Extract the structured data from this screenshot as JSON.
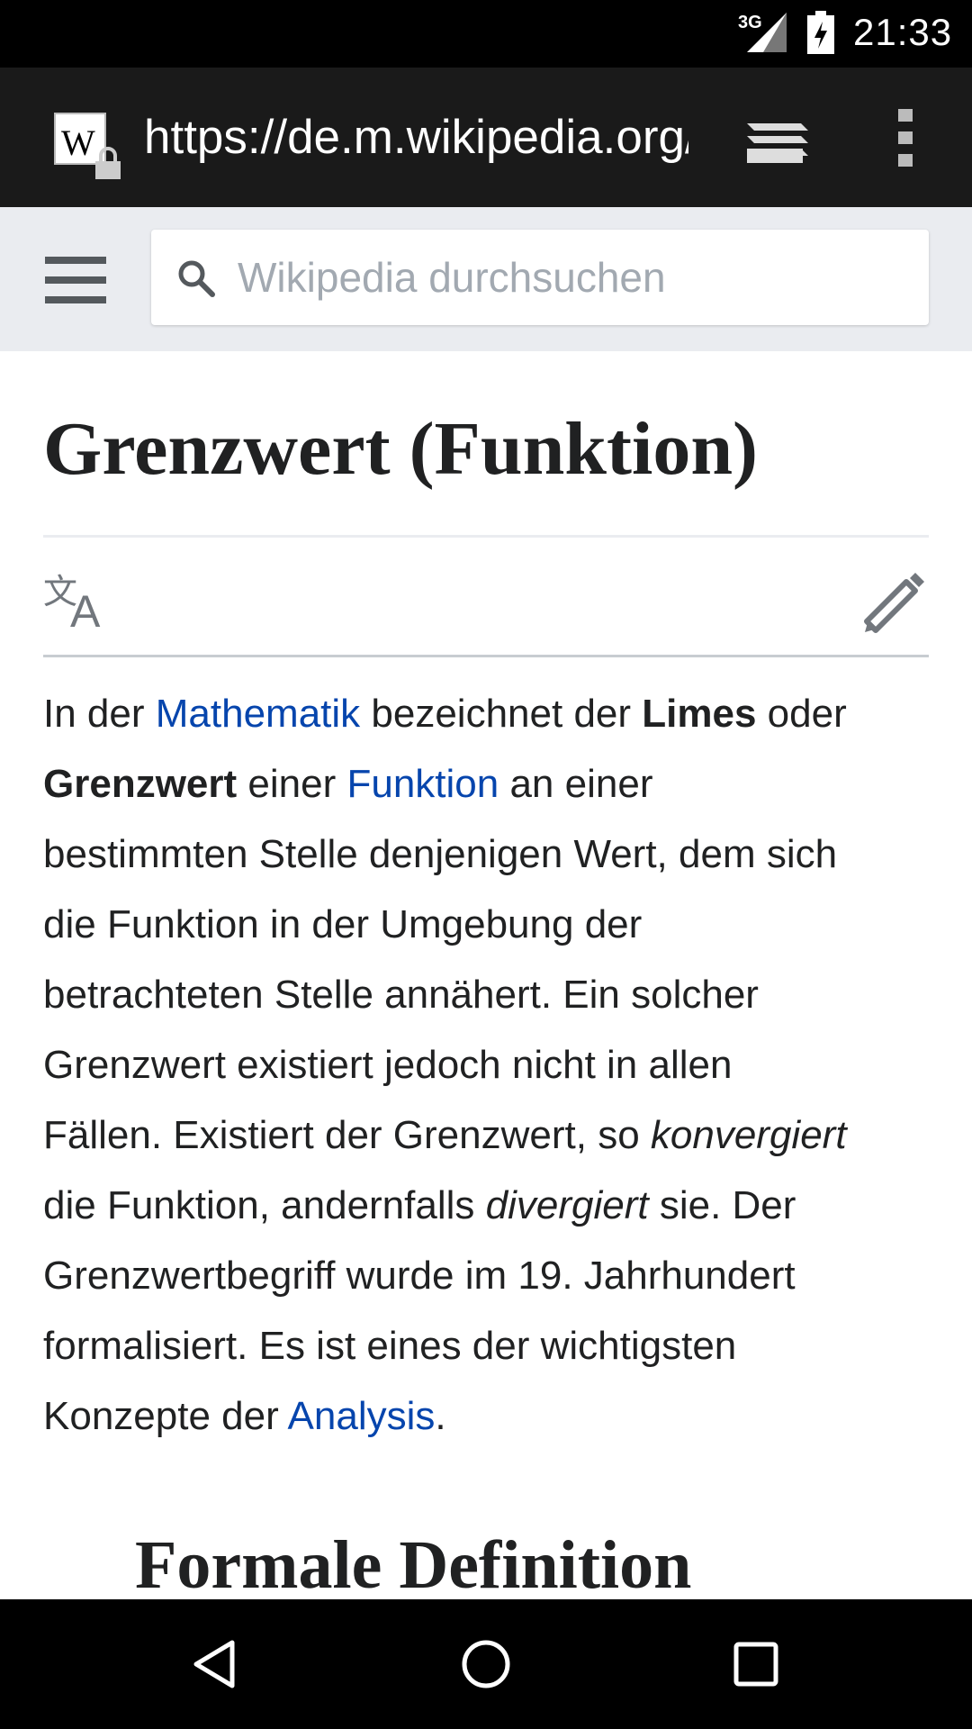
{
  "status_bar": {
    "network": "3G",
    "time": "21:33"
  },
  "browser": {
    "url": "https://de.m.wikipedia.org/wiki/Grenzwert_(Funktion)",
    "favicon_letter": "W"
  },
  "header": {
    "search_placeholder": "Wikipedia durchsuchen"
  },
  "article": {
    "title": "Grenzwert (Funktion)",
    "lines": [
      [
        {
          "t": "In der "
        },
        {
          "t": "Mathematik",
          "s": "link"
        },
        {
          "t": " bezeichnet der "
        },
        {
          "t": "Limes",
          "s": "bold"
        },
        {
          "t": " oder"
        }
      ],
      [
        {
          "t": "Grenzwert",
          "s": "bold"
        },
        {
          "t": " einer "
        },
        {
          "t": "Funktion",
          "s": "link"
        },
        {
          "t": " an einer"
        }
      ],
      [
        {
          "t": "bestimmten Stelle denjenigen Wert, dem sich"
        }
      ],
      [
        {
          "t": "die Funktion in der Umgebung der"
        }
      ],
      [
        {
          "t": "betrachteten Stelle annähert. Ein solcher"
        }
      ],
      [
        {
          "t": "Grenzwert existiert jedoch nicht in allen"
        }
      ],
      [
        {
          "t": "Fällen. Existiert der Grenzwert, so "
        },
        {
          "t": "konvergiert",
          "s": "italic"
        }
      ],
      [
        {
          "t": "die Funktion, andernfalls "
        },
        {
          "t": "divergiert",
          "s": "italic"
        },
        {
          "t": " sie. Der"
        }
      ],
      [
        {
          "t": "Grenzwertbegriff wurde im 19. Jahrhundert"
        }
      ],
      [
        {
          "t": "formalisiert. Es ist eines der wichtigsten"
        }
      ],
      [
        {
          "t": "Konzepte der "
        },
        {
          "t": "Analysis",
          "s": "link"
        },
        {
          "t": "."
        }
      ]
    ],
    "section_heading": "Formale Definition"
  },
  "icons": {
    "favicon": "wikipedia-w-icon",
    "lock": "lock-icon",
    "tabs": "tabs-icon",
    "overflow": "overflow-menu-icon",
    "menu": "hamburger-icon",
    "search": "search-icon",
    "language": "language-icon",
    "edit": "edit-pencil-icon",
    "back": "back-icon",
    "home": "home-icon",
    "recents": "recents-icon"
  },
  "colors": {
    "link": "#0645ad",
    "text": "#202122",
    "header_bg": "#eaecf0",
    "toolbar_bg": "#1a1a1a"
  }
}
